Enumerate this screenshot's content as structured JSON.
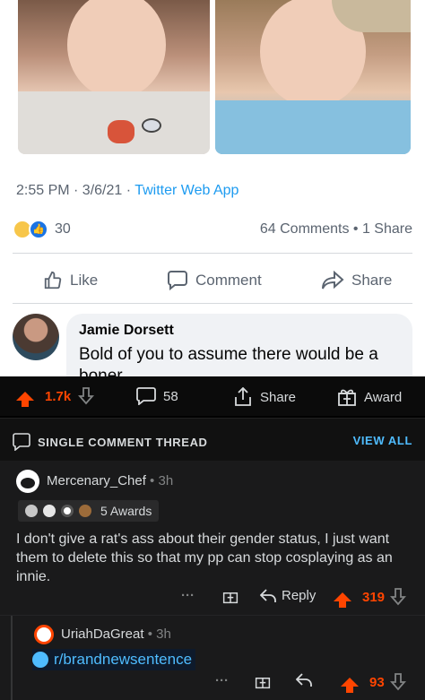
{
  "facebook": {
    "tweet_meta": "2:55 PM · 3/6/21 · ",
    "tweet_app": "Twitter Web App",
    "reaction_count": "30",
    "counts_text": "64 Comments • 1 Share",
    "actions": {
      "like": "Like",
      "comment": "Comment",
      "share": "Share"
    },
    "comment": {
      "author": "Jamie Dorsett",
      "text": "Bold of you to assume there would be a boner"
    }
  },
  "reddit": {
    "post_bar": {
      "score": "1.7k",
      "comments": "58",
      "share": "Share",
      "award": "Award"
    },
    "thread_bar": {
      "label": "SINGLE COMMENT THREAD",
      "view_all": "VIEW ALL"
    },
    "comment": {
      "author": "Mercenary_Chef",
      "age": " • 3h",
      "awards": "5 Awards",
      "body": "I don't give a rat's ass about their gender status, I just want them to delete this so that my pp can stop cosplaying as an innie.",
      "more": "···",
      "reply": "Reply",
      "score": "319"
    },
    "reply": {
      "author": "UriahDaGreat",
      "age": " • 3h",
      "subreddit_link": "r/brandnewsentence",
      "more": "···",
      "score": "93"
    }
  },
  "colors": {
    "upvote": "#ff4500",
    "link_blue": "#4fbcff",
    "fb_blue": "#1b74e4"
  }
}
